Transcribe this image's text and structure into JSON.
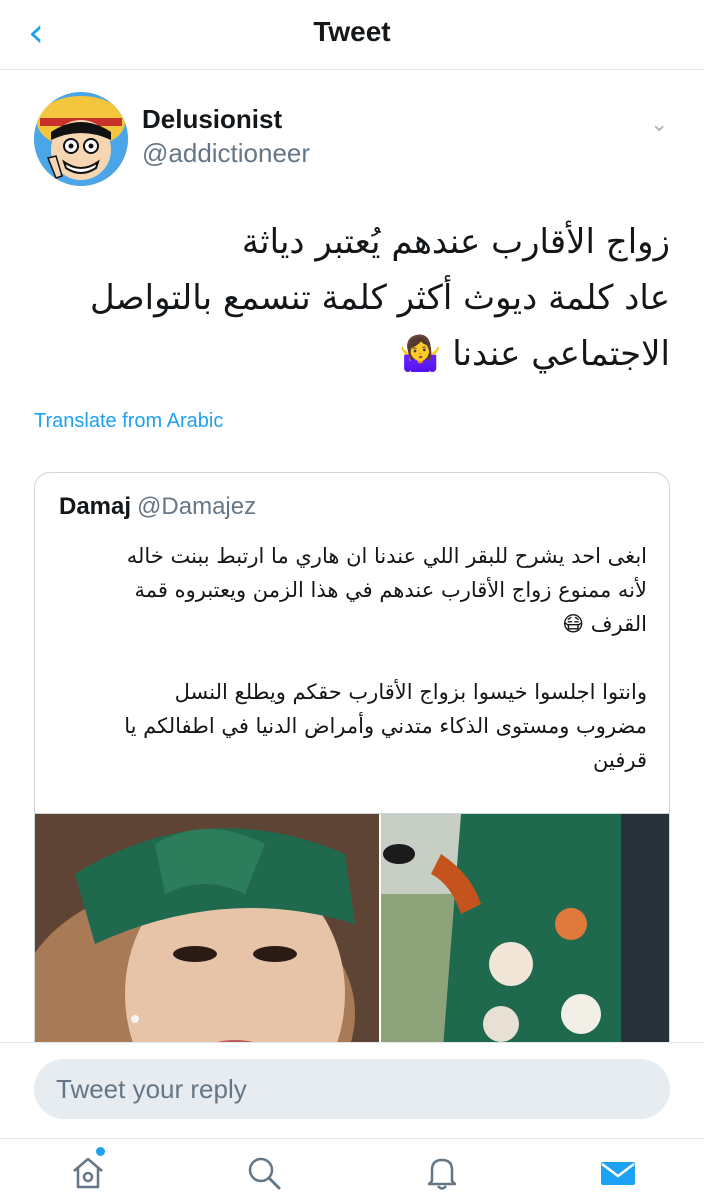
{
  "header": {
    "back_icon": "chevron-left-icon",
    "title": "Tweet"
  },
  "tweet": {
    "display_name": "Delusionist",
    "handle": "@addictioneer",
    "text": "زواج الأقارب عندهم يُعتبر دياثة\nعاد كلمة ديوث أكثر كلمة تنسمع بالتواصل\nالاجتماعي عندنا 🤷‍♀️",
    "translate_label": "Translate from Arabic",
    "more_icon": "chevron-down-icon"
  },
  "quote": {
    "display_name": "Damaj",
    "handle": "@Damajez",
    "text": "ابغى احد يشرح للبقر اللي عندنا ان هاري ما ارتبط ببنت خاله\nلأنه ممنوع زواج الأقارب عندهم في هذا الزمن ويعتبروه قمة\nالقرف 😷\n\nوانتوا اجلسوا خيسوا بزواج الأقارب حقكم ويطلع النسل\nمضروب ومستوى الذكاء متدني وأمراض الدنيا في اطفالكم يا\nقرفين"
  },
  "reply": {
    "placeholder": "Tweet your reply"
  },
  "tabs": [
    {
      "icon": "home-icon",
      "active": false,
      "badge_dot": true
    },
    {
      "icon": "search-icon",
      "active": false
    },
    {
      "icon": "bell-icon",
      "active": false
    },
    {
      "icon": "mail-icon",
      "active": true
    }
  ],
  "colors": {
    "accent": "#1da1f2",
    "text": "#14171a",
    "muted": "#657786",
    "border": "#e1e8ed"
  }
}
